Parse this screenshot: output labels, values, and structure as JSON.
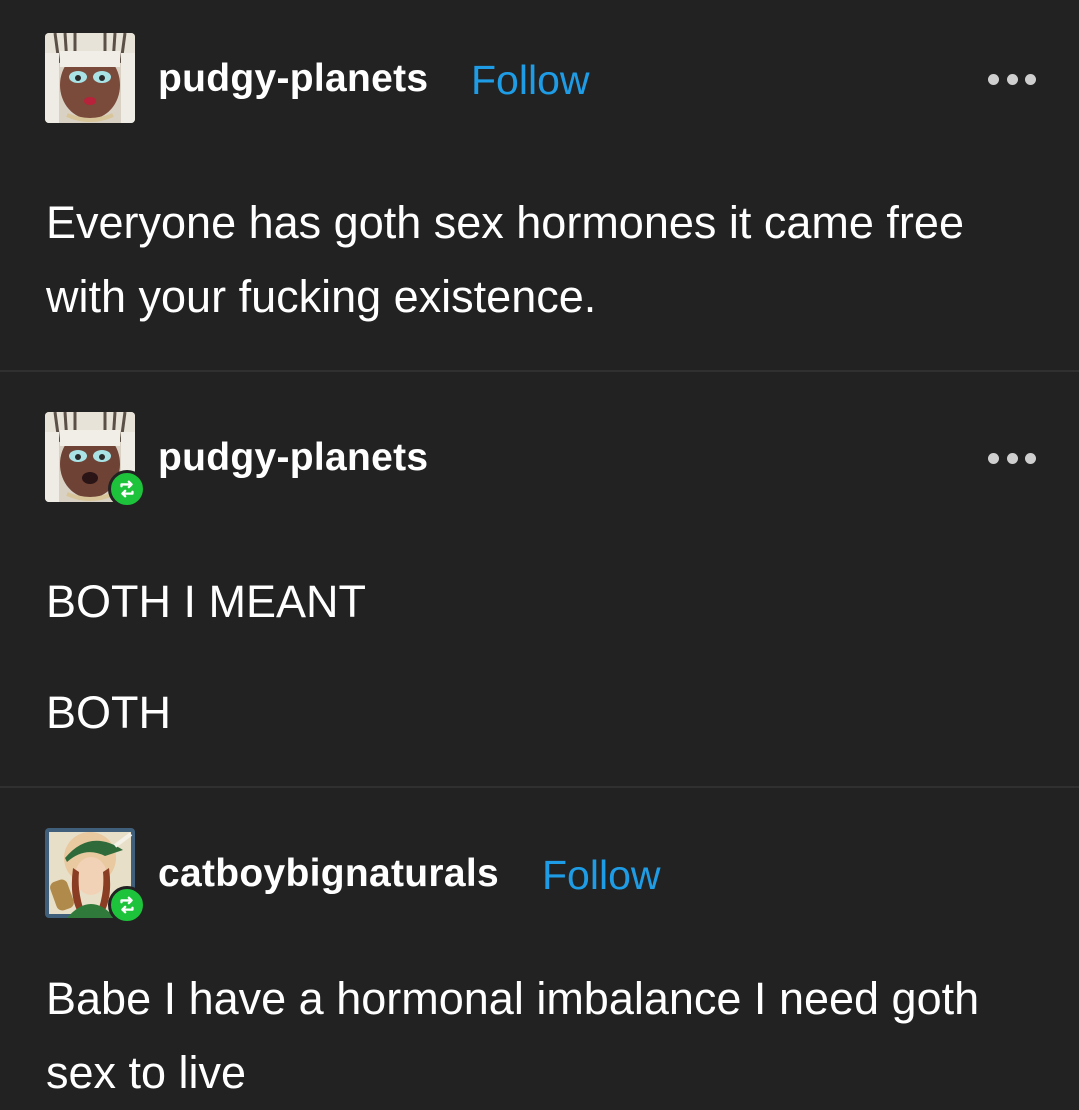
{
  "posts": [
    {
      "username": "pudgy-planets",
      "follow_label": "Follow",
      "avatar_icon": "anime-avatar-icon",
      "more_icon": "more-options-icon",
      "text": "Everyone has goth sex hormones it came free with your fucking existence."
    },
    {
      "username": "pudgy-planets",
      "avatar_icon": "anime-avatar-icon",
      "badge_icon": "reblog-icon",
      "more_icon": "more-options-icon",
      "paragraphs": [
        "BOTH I MEANT",
        "BOTH"
      ]
    },
    {
      "username": "catboybignaturals",
      "follow_label": "Follow",
      "avatar_icon": "anime-avatar-icon",
      "badge_icon": "reblog-icon"
    },
    {
      "text": "Babe I have a hormonal imbalance I need goth sex to live"
    }
  ],
  "colors": {
    "background": "#222222",
    "follow": "#1e9de6",
    "reblog_badge": "#1cc33b",
    "text": "#ffffff"
  }
}
